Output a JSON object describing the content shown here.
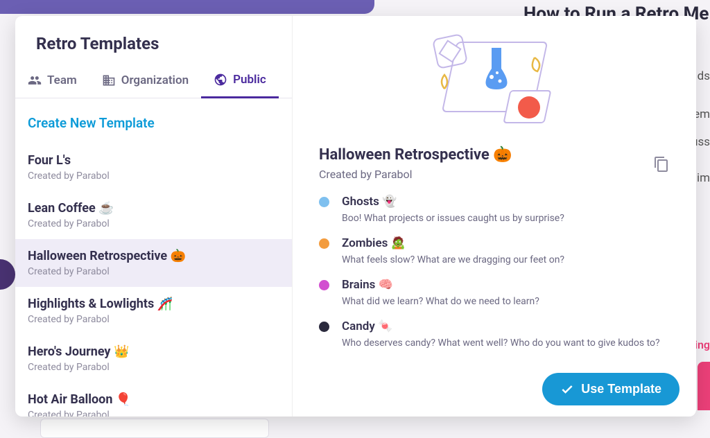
{
  "background": {
    "heading": "How to Run a Retro Me",
    "side_texts": [
      "ds",
      "em",
      "uss",
      "im"
    ],
    "pink_text": "ting"
  },
  "modal": {
    "title": "Retro Templates",
    "tabs": [
      {
        "key": "team",
        "label": "Team"
      },
      {
        "key": "organization",
        "label": "Organization"
      },
      {
        "key": "public",
        "label": "Public"
      }
    ],
    "active_tab": "public",
    "create_label": "Create New Template",
    "templates": [
      {
        "name": "Four L's",
        "author": "Created by Parabol"
      },
      {
        "name": "Lean Coffee ☕",
        "author": "Created by Parabol"
      },
      {
        "name": "Halloween Retrospective 🎃",
        "author": "Created by Parabol",
        "selected": true
      },
      {
        "name": "Highlights & Lowlights 🎢",
        "author": "Created by Parabol"
      },
      {
        "name": "Hero's Journey 👑",
        "author": "Created by Parabol"
      },
      {
        "name": "Hot Air Balloon 🎈",
        "author": "Created by Parabol"
      }
    ]
  },
  "detail": {
    "title": "Halloween Retrospective 🎃",
    "author": "Created by Parabol",
    "use_button": "Use Template",
    "prompts": [
      {
        "name": "Ghosts 👻",
        "desc": "Boo! What projects or issues caught us by surprise?",
        "color": "#7fc0ef"
      },
      {
        "name": "Zombies 🧟",
        "desc": "What feels slow? What are we dragging our feet on?",
        "color": "#f39c3e"
      },
      {
        "name": "Brains 🧠",
        "desc": "What did we learn? What do we need to learn?",
        "color": "#d24fd0"
      },
      {
        "name": "Candy 🍬",
        "desc": "Who deserves candy? What went well? Who do you want to give kudos to?",
        "color": "#2b2a3d"
      }
    ]
  }
}
